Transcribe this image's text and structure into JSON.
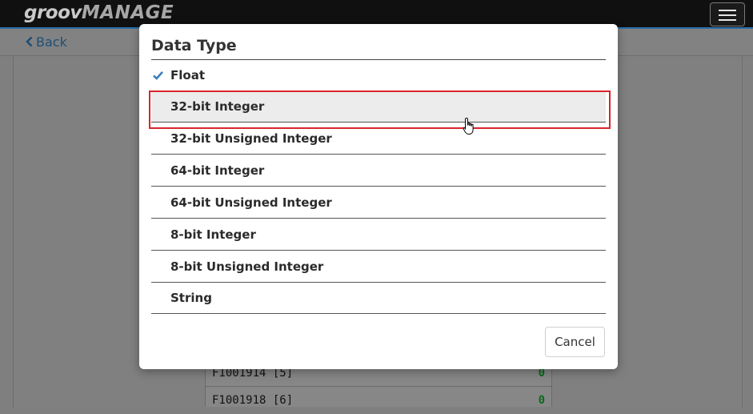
{
  "app": {
    "logo_prefix": "groov",
    "logo_suffix": "MANAGE"
  },
  "subbar": {
    "back_label": "Back"
  },
  "background_table": {
    "rows": [
      {
        "tag": "F1001914 [5]",
        "value": "0"
      },
      {
        "tag": "F1001918 [6]",
        "value": "0"
      }
    ]
  },
  "dialog": {
    "title": "Data Type",
    "selected": "Float",
    "hovered": "32-bit Integer",
    "options": [
      "Float",
      "32-bit Integer",
      "32-bit Unsigned Integer",
      "64-bit Integer",
      "64-bit Unsigned Integer",
      "8-bit Integer",
      "8-bit Unsigned Integer",
      "String"
    ],
    "cancel_label": "Cancel"
  },
  "colors": {
    "check": "#3a7fbf",
    "highlight_border": "#d9262c",
    "hover_row": "#ececec"
  },
  "icons": {
    "check": "check-icon",
    "back": "chevron-left-icon",
    "menu": "hamburger-menu-icon",
    "cursor": "hand-pointer-icon"
  }
}
